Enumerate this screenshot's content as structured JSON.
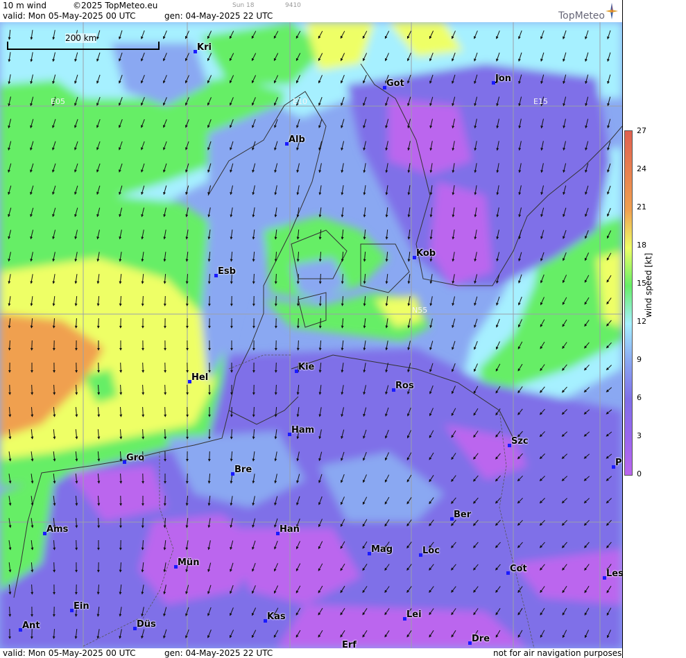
{
  "header": {
    "product": "10 m wind",
    "copyright": "©2025 TopMeteo.eu",
    "valid": "valid:  Mon  05-May-2025  00 UTC",
    "gen": "gen: 04-May-2025 22 UTC",
    "sun": "Sun 18",
    "code": "9410",
    "brand": "TopMeteo"
  },
  "footer": {
    "valid": "valid:  Mon  05-May-2025  00 UTC",
    "gen": "gen: 04-May-2025 22 UTC",
    "disclaimer": "not for air navigation purposes"
  },
  "scale": {
    "label": "200 km"
  },
  "grid_labels": {
    "e05": "E05",
    "e10": "E10",
    "e15": "E15",
    "n55": "N55"
  },
  "legend": {
    "title": "wind speed [kt]",
    "ticks": [
      "27",
      "24",
      "21",
      "18",
      "15",
      "12",
      "9",
      "6",
      "3",
      "0"
    ],
    "colors": [
      "#bb66ee",
      "#9966ee",
      "#7f6fe8",
      "#8aa8f2",
      "#a6f0ff",
      "#66ee66",
      "#eeff66",
      "#f0a050",
      "#e06050"
    ]
  },
  "cities": [
    {
      "name": "Kri"
    },
    {
      "name": "Got"
    },
    {
      "name": "Jon"
    },
    {
      "name": "Alb"
    },
    {
      "name": "Esb"
    },
    {
      "name": "Kob"
    },
    {
      "name": "Kie"
    },
    {
      "name": "Hel"
    },
    {
      "name": "Ros"
    },
    {
      "name": "Ham"
    },
    {
      "name": "Szc"
    },
    {
      "name": "Gro"
    },
    {
      "name": "Bre"
    },
    {
      "name": "P"
    },
    {
      "name": "Ber"
    },
    {
      "name": "Ams"
    },
    {
      "name": "Han"
    },
    {
      "name": "Mag"
    },
    {
      "name": "Loc"
    },
    {
      "name": "Mün"
    },
    {
      "name": "Cot"
    },
    {
      "name": "Les"
    },
    {
      "name": "Ein"
    },
    {
      "name": "Kas"
    },
    {
      "name": "Lei"
    },
    {
      "name": "Ant"
    },
    {
      "name": "Düs"
    },
    {
      "name": "Dre"
    },
    {
      "name": "Erf"
    }
  ]
}
